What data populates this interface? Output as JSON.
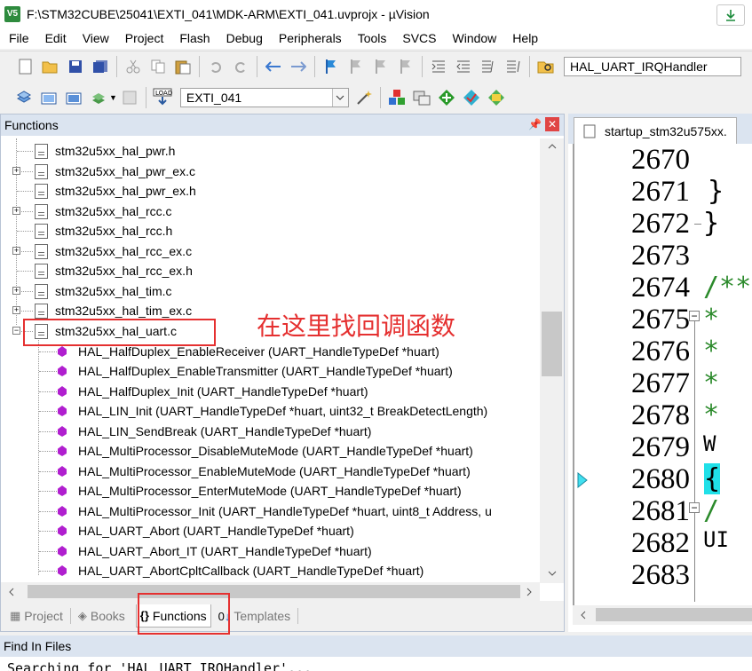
{
  "window": {
    "title": "F:\\STM32CUBE\\25041\\EXTI_041\\MDK-ARM\\EXTI_041.uvprojx - µVision",
    "app_icon_text": "V5"
  },
  "menu": [
    "File",
    "Edit",
    "View",
    "Project",
    "Flash",
    "Debug",
    "Peripherals",
    "Tools",
    "SVCS",
    "Window",
    "Help"
  ],
  "toolbar": {
    "find_combo_value": "HAL_UART_IRQHandler",
    "target_combo_value": "EXTI_041"
  },
  "functions_panel": {
    "title": "Functions",
    "files": [
      {
        "name": "stm32u5xx_hal_pwr.h",
        "expandable": false
      },
      {
        "name": "stm32u5xx_hal_pwr_ex.c",
        "expandable": true
      },
      {
        "name": "stm32u5xx_hal_pwr_ex.h",
        "expandable": false
      },
      {
        "name": "stm32u5xx_hal_rcc.c",
        "expandable": true
      },
      {
        "name": "stm32u5xx_hal_rcc.h",
        "expandable": false
      },
      {
        "name": "stm32u5xx_hal_rcc_ex.c",
        "expandable": true
      },
      {
        "name": "stm32u5xx_hal_rcc_ex.h",
        "expandable": false
      },
      {
        "name": "stm32u5xx_hal_tim.c",
        "expandable": true
      },
      {
        "name": "stm32u5xx_hal_tim_ex.c",
        "expandable": true
      },
      {
        "name": "stm32u5xx_hal_uart.c",
        "expandable": true
      }
    ],
    "functions": [
      "HAL_HalfDuplex_EnableReceiver (UART_HandleTypeDef *huart)",
      "HAL_HalfDuplex_EnableTransmitter (UART_HandleTypeDef *huart)",
      "HAL_HalfDuplex_Init (UART_HandleTypeDef *huart)",
      "HAL_LIN_Init (UART_HandleTypeDef *huart, uint32_t BreakDetectLength)",
      "HAL_LIN_SendBreak (UART_HandleTypeDef *huart)",
      "HAL_MultiProcessor_DisableMuteMode (UART_HandleTypeDef *huart)",
      "HAL_MultiProcessor_EnableMuteMode (UART_HandleTypeDef *huart)",
      "HAL_MultiProcessor_EnterMuteMode (UART_HandleTypeDef *huart)",
      "HAL_MultiProcessor_Init (UART_HandleTypeDef *huart, uint8_t Address, u",
      "HAL_UART_Abort (UART_HandleTypeDef *huart)",
      "HAL_UART_Abort_IT (UART_HandleTypeDef *huart)",
      "HAL_UART_AbortCpltCallback (UART_HandleTypeDef *huart)"
    ],
    "annotation": "在这里找回调函数"
  },
  "bottom_tabs": [
    {
      "label": "Project",
      "icon": "project-icon"
    },
    {
      "label": "Books",
      "icon": "books-icon"
    },
    {
      "label": "Functions",
      "icon": "functions-icon",
      "active": true
    },
    {
      "label": "Templates",
      "icon": "templates-icon"
    }
  ],
  "editor": {
    "tab_label": "startup_stm32u575xx.",
    "lines": [
      {
        "num": "2670",
        "code": ""
      },
      {
        "num": "2671",
        "code": "  }"
      },
      {
        "num": "2672",
        "code": "}"
      },
      {
        "num": "2673",
        "code": ""
      },
      {
        "num": "2674",
        "code": "/**"
      },
      {
        "num": "2675",
        "code": "  *"
      },
      {
        "num": "2676",
        "code": "  *"
      },
      {
        "num": "2677",
        "code": "  *"
      },
      {
        "num": "2678",
        "code": "  *"
      },
      {
        "num": "2679",
        "code": " W"
      },
      {
        "num": "2680",
        "code": "{"
      },
      {
        "num": "2681",
        "code": "  /"
      },
      {
        "num": "2682",
        "code": " UI"
      },
      {
        "num": "2683",
        "code": ""
      }
    ]
  },
  "find_in_files": {
    "title": "Find In Files",
    "output": "Searching for 'HAL_UART_IRQHandler'..."
  },
  "colors": {
    "annotation": "#e53030",
    "function_icon": "#b01fcf",
    "panel_header": "#dbe4f0",
    "comment_green": "#2b8a2b"
  }
}
